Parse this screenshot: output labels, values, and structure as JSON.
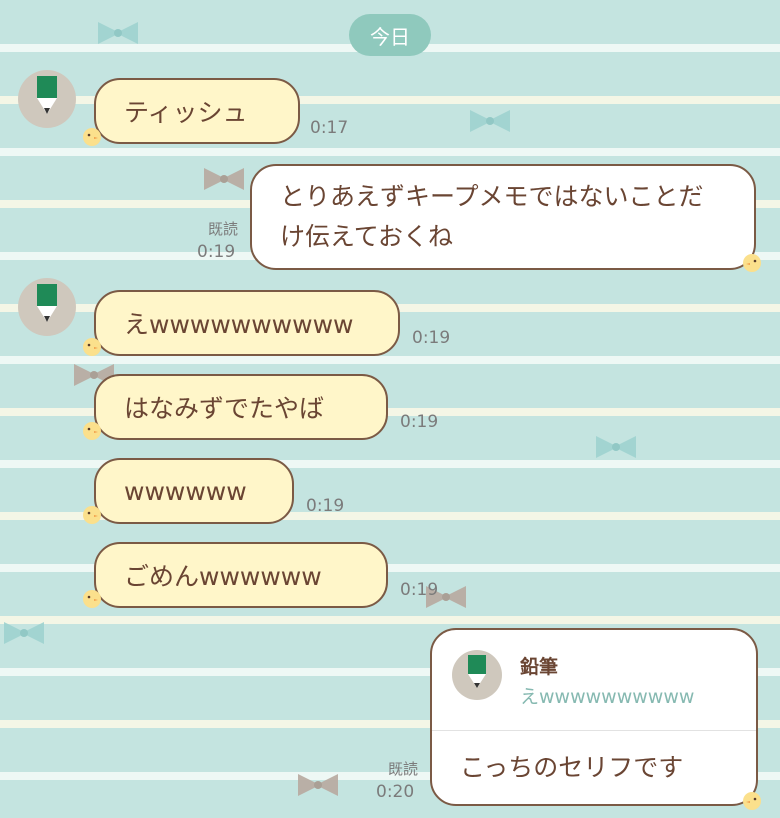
{
  "date_label": "今日",
  "contact_name": "鉛筆",
  "read_label": "既読",
  "colors": {
    "bubble_left": "#fff6c9",
    "bubble_right": "#ffffff",
    "border": "#7b5a45",
    "text": "#6a4533",
    "date_badge": "#8fc9bd"
  },
  "messages": [
    {
      "side": "left",
      "text": "ティッシュ",
      "time": "0:17"
    },
    {
      "side": "right",
      "text": "とりあえずキープメモではないことだけ伝えておくね",
      "time": "0:19"
    },
    {
      "side": "left",
      "text": "えwwwwwwwwww",
      "time": "0:19"
    },
    {
      "side": "left",
      "text": "はなみずでたやば",
      "time": "0:19"
    },
    {
      "side": "left",
      "text": "wwwwww",
      "time": "0:19"
    },
    {
      "side": "left",
      "text": "ごめんwwwwww",
      "time": "0:19"
    }
  ],
  "reply": {
    "quote_name": "鉛筆",
    "quote_text": "えwwwwwwwwww",
    "text": "こっちのセリフです",
    "time": "0:20"
  }
}
